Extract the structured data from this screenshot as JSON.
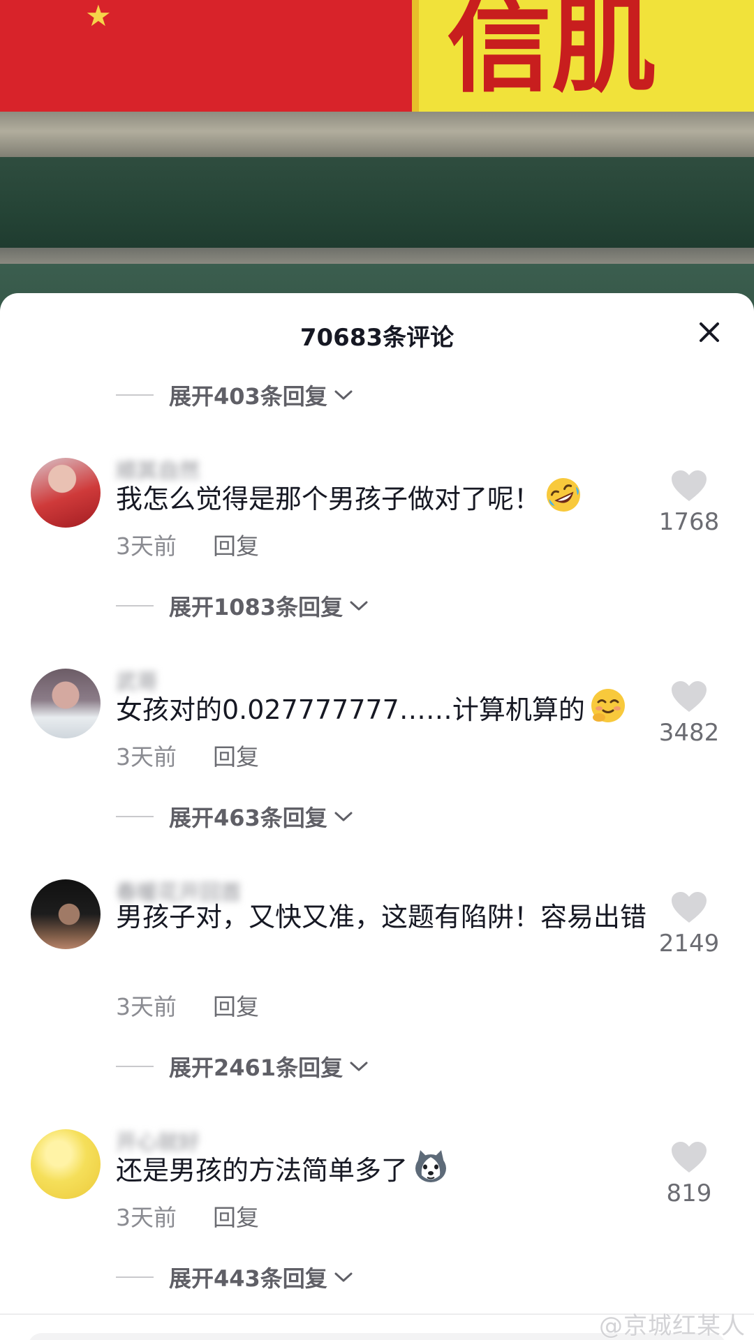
{
  "video": {
    "sign_text": "信肌"
  },
  "sheet": {
    "title": "70683条评论",
    "first_expand": "展开403条回复"
  },
  "comments": [
    {
      "username": "顺其自然",
      "text": "我怎么觉得是那个男孩子做对了呢！",
      "emoji": "rolling-laughing-emoji",
      "time": "3天前",
      "reply": "回复",
      "likes": "1768",
      "expand": "展开1083条回复"
    },
    {
      "username": "武哥",
      "text": "女孩对的0.027777777……计算机算的",
      "emoji": "shy-smile-emoji",
      "time": "3天前",
      "reply": "回复",
      "likes": "3482",
      "expand": "展开463条回复"
    },
    {
      "username": "春暖花开回首",
      "text": "男孩子对，又快又准，这题有陷阱！容易出错",
      "emoji": "",
      "time": "3天前",
      "reply": "回复",
      "likes": "2149",
      "expand": "展开2461条回复"
    },
    {
      "username": "开心就好",
      "text": "还是男孩的方法简单多了",
      "emoji": "husky-emoji",
      "time": "3天前",
      "reply": "回复",
      "likes": "819",
      "expand": "展开443条回复"
    }
  ],
  "watermark": "@京城红某人",
  "colors": {
    "like_icon": "#d6d6d9",
    "secondary_text": "#8a8b91",
    "primary_text": "#161823"
  }
}
